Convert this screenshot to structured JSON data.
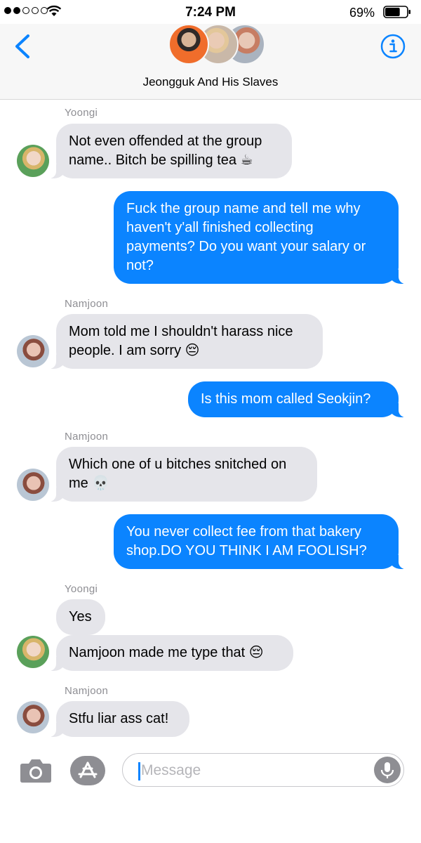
{
  "status_bar": {
    "time": "7:24 PM",
    "battery_percent": "69%",
    "signal_bars_filled": 2,
    "signal_bars_total": 5,
    "battery_level": 0.69
  },
  "header": {
    "group_name": "Jeongguk And His Slaves",
    "back_icon": "chevron-left-icon",
    "info_icon": "info-icon"
  },
  "messages": [
    {
      "sender": "Yoongi",
      "text": "Not even offended at the group name.. Bitch be spilling tea ☕",
      "type": "received",
      "avatar": "yoongi"
    },
    {
      "text": "Fuck the group name and tell me why haven't y'all finished collecting payments? Do you want your salary or not?",
      "type": "sent"
    },
    {
      "sender": "Namjoon",
      "text": "Mom told me I shouldn't harass nice people. I am sorry 😔",
      "type": "received",
      "avatar": "namjoon"
    },
    {
      "text": "Is this mom called Seokjin?",
      "type": "sent"
    },
    {
      "sender": "Namjoon",
      "text": "Which one of u bitches snitched on me 💀",
      "type": "received",
      "avatar": "namjoon"
    },
    {
      "text": "You never collect fee from that bakery shop.DO YOU THINK I AM FOOLISH?",
      "type": "sent"
    },
    {
      "sender": "Yoongi",
      "text": "Yes",
      "type": "received"
    },
    {
      "text": "Namjoon made me type that 😔",
      "type": "received",
      "avatar": "yoongi"
    },
    {
      "sender": "Namjoon",
      "text": "Stfu liar ass cat!",
      "type": "received",
      "avatar": "namjoon"
    }
  ],
  "input_bar": {
    "placeholder": "Message",
    "camera_icon": "camera-icon",
    "apps_icon": "app-store-icon",
    "mic_icon": "microphone-icon"
  },
  "colors": {
    "sent_bubble": "#0b84ff",
    "received_bubble": "#e5e5ea",
    "accent": "#0b84ff"
  }
}
